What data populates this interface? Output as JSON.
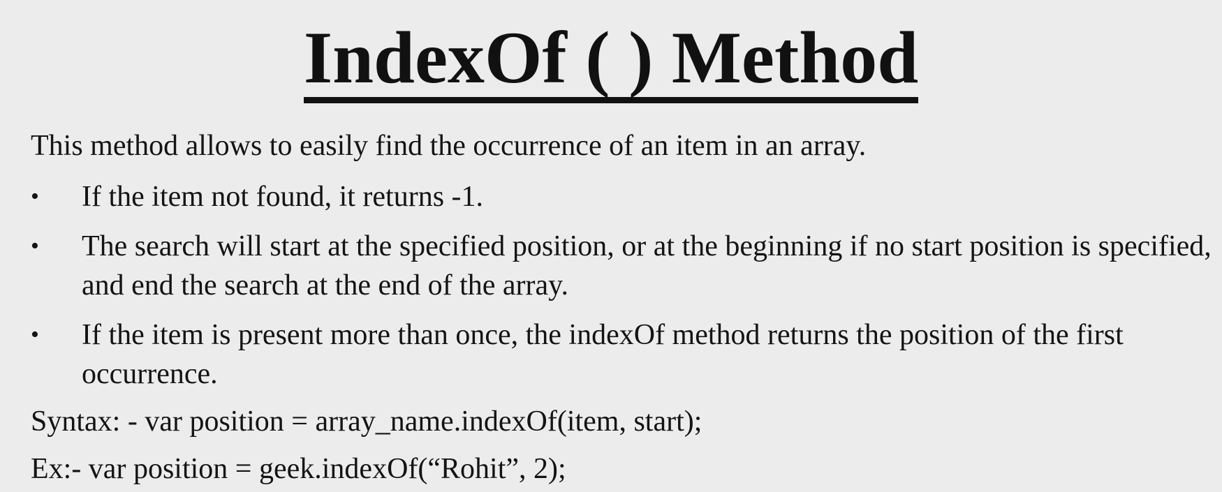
{
  "title": "IndexOf ( ) Method",
  "intro": "This method allows to easily find the occurrence of an item in an array.",
  "bullet_symbol": "•",
  "bullets": [
    "If the item not found, it returns -1.",
    "The search will start at the specified position, or at the beginning if no start position is specified, and end the search at the end of the array.",
    "If the item is present more than once, the indexOf method returns the position of the first occurrence."
  ],
  "syntax": "Syntax: - var position = array_name.indexOf(item, start);",
  "example": "Ex:- var position = geek.indexOf(“Rohit”, 2);"
}
